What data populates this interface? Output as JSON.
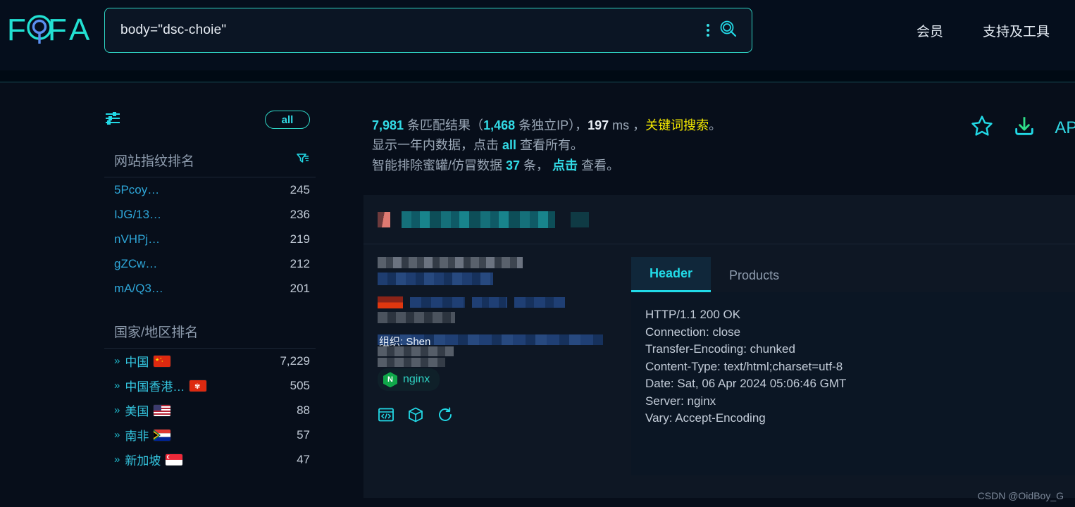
{
  "brand": {
    "name": "FOFA",
    "logo_icon": "fofa-logo-icon"
  },
  "search": {
    "query": "body=\"dsc-choie\"",
    "placeholder": "",
    "more_icon": "vertical-dots-icon",
    "search_icon": "search-icon"
  },
  "nav": {
    "items": [
      {
        "label": "会员",
        "name": "nav-member"
      },
      {
        "label": "支持及工具",
        "name": "nav-support-tools"
      }
    ]
  },
  "sidebar": {
    "filter_icon": "sliders-filter-icon",
    "all_label": "all",
    "fingerprint_panel": {
      "title": "网站指纹排名",
      "filter_icon": "funnel-filter-icon",
      "rows": [
        {
          "label": "5Pcoy…",
          "value": "245"
        },
        {
          "label": "IJG/13…",
          "value": "236"
        },
        {
          "label": "nVHPj…",
          "value": "219"
        },
        {
          "label": "gZCw…",
          "value": "212"
        },
        {
          "label": "mA/Q3…",
          "value": "201"
        }
      ]
    },
    "country_panel": {
      "title": "国家/地区排名",
      "rows": [
        {
          "label": "中国",
          "value": "7,229",
          "flag": "cn"
        },
        {
          "label": "中国香港…",
          "value": "505",
          "flag": "hk"
        },
        {
          "label": "美国",
          "value": "88",
          "flag": "us"
        },
        {
          "label": "南非",
          "value": "57",
          "flag": "za"
        },
        {
          "label": "新加坡",
          "value": "47",
          "flag": "sg"
        }
      ]
    }
  },
  "summary": {
    "total": "7,981",
    "total_suffix": " 条匹配结果（",
    "unique_ip": "1,468",
    "unique_suffix": " 条独立IP），",
    "time_ms": "197",
    "time_unit": " ms ，",
    "mode": "关键词搜索",
    "mode_suffix": "。",
    "line2_prefix": "显示一年内数据，点击 ",
    "line2_link": "all",
    "line2_suffix": " 查看所有。",
    "line3_prefix": "智能排除蜜罐/仿冒数据 ",
    "line3_count": "37",
    "line3_mid": " 条，  ",
    "line3_link": "点击",
    "line3_suffix": " 查看。"
  },
  "toolbar": {
    "favorite_icon": "star-icon",
    "download_icon": "download-icon",
    "api_label": "API"
  },
  "result": {
    "tabs": [
      {
        "label": "Header",
        "active": true
      },
      {
        "label": "Products",
        "active": false
      }
    ],
    "header_text": "HTTP/1.1 200 OK\nConnection: close\nTransfer-Encoding: chunked\nContent-Type: text/html;charset=utf-8\nDate: Sat, 06 Apr 2024 05:06:46 GMT\nServer: nginx\nVary: Accept-Encoding",
    "org_label": "组织: Shen",
    "product_badge": "nginx",
    "action_icons": [
      "code-window-icon",
      "cube-icon",
      "refresh-icon"
    ]
  },
  "watermark": "CSDN @OidBoy_G",
  "colors": {
    "accent_cyan": "#32dbe6",
    "accent_teal": "#2fd4c4",
    "highlight_yellow": "#f5ea00",
    "page_bg": "#070e1a",
    "card_bg": "#0e1724"
  }
}
